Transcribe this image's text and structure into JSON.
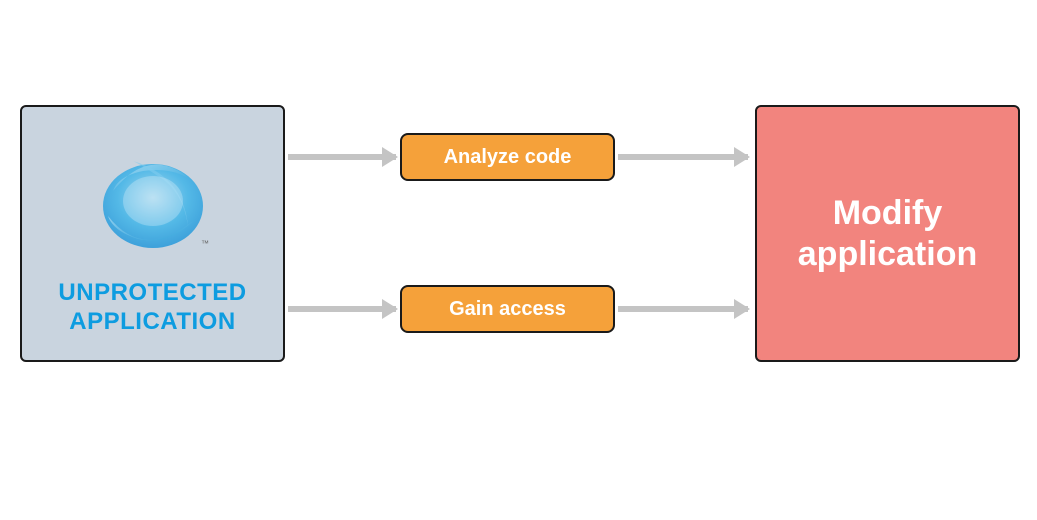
{
  "diagram": {
    "source": {
      "label": "UNPROTECTED APPLICATION",
      "icon_name": "silverlight-logo"
    },
    "steps": {
      "top": {
        "label": "Analyze code"
      },
      "bottom": {
        "label": "Gain access"
      }
    },
    "target": {
      "label": "Modify application"
    },
    "colors": {
      "source_bg": "#c9d4df",
      "source_text": "#0d9ce0",
      "step_bg": "#f5a13a",
      "target_bg": "#f2847e",
      "arrow": "#c4c4c4",
      "border": "#1a1a1a"
    }
  }
}
